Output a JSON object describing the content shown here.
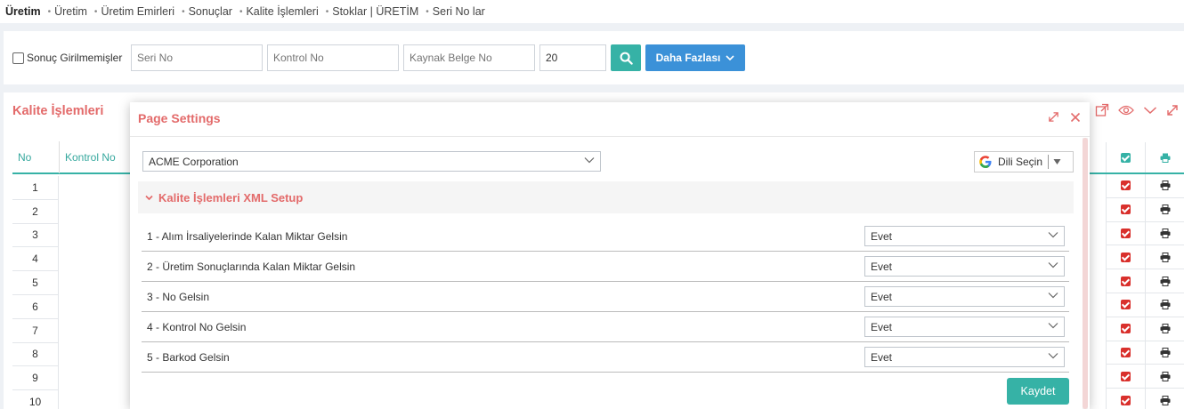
{
  "breadcrumb": {
    "items": [
      "Üretim",
      "Üretim",
      "Üretim Emirleri",
      "Sonuçlar",
      "Kalite İşlemleri",
      "Stoklar | ÜRETİM",
      "Seri No lar"
    ]
  },
  "filters": {
    "checkbox_label": "Sonuç Girilmemişler",
    "seri_no_placeholder": "Seri No",
    "kontrol_no_placeholder": "Kontrol No",
    "kaynak_belge_placeholder": "Kaynak Belge No",
    "count_value": "20",
    "more_label": "Daha Fazlası"
  },
  "panel": {
    "title": "Kalite İşlemleri",
    "columns": {
      "no": "No",
      "kontrol_no": "Kontrol No"
    },
    "row_numbers": [
      "1",
      "2",
      "3",
      "4",
      "5",
      "6",
      "7",
      "8",
      "9",
      "10"
    ]
  },
  "modal": {
    "title": "Page Settings",
    "company": "ACME Corporation",
    "language_label": "Dili Seçin",
    "section_title": "Kalite İşlemleri XML Setup",
    "settings": [
      {
        "label": "1 - Alım İrsaliyelerinde Kalan Miktar Gelsin",
        "value": "Evet"
      },
      {
        "label": "2 - Üretim Sonuçlarında Kalan Miktar Gelsin",
        "value": "Evet"
      },
      {
        "label": "3 - No Gelsin",
        "value": "Evet"
      },
      {
        "label": "4 - Kontrol No Gelsin",
        "value": "Evet"
      },
      {
        "label": "5 - Barkod Gelsin",
        "value": "Evet"
      }
    ],
    "save_label": "Kaydet"
  },
  "colors": {
    "accent_red": "#e36a6a",
    "teal": "#36b2a6",
    "blue": "#3b91d8"
  }
}
